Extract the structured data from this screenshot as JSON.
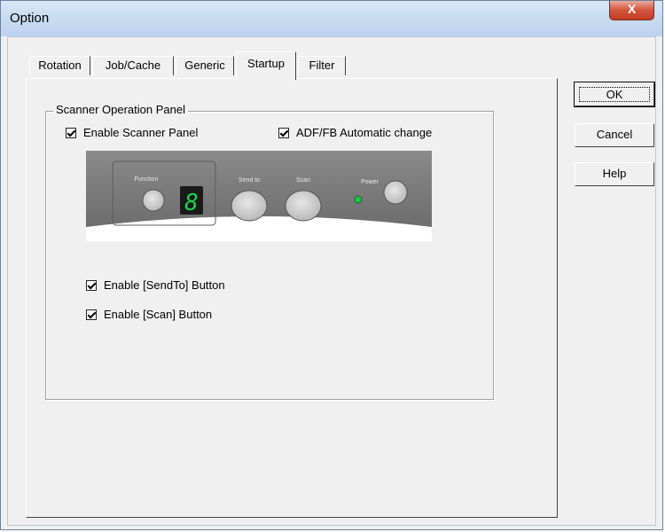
{
  "window": {
    "title": "Option",
    "close_glyph": "X"
  },
  "tabs": [
    {
      "label": "Rotation",
      "active": false
    },
    {
      "label": "Job/Cache",
      "active": false
    },
    {
      "label": "Generic",
      "active": false
    },
    {
      "label": "Startup",
      "active": true
    },
    {
      "label": "Filter",
      "active": false
    }
  ],
  "group": {
    "title": "Scanner Operation Panel",
    "enable_panel": {
      "label": "Enable Scanner Panel",
      "checked": true
    },
    "adf_fb_auto": {
      "label": "ADF/FB Automatic change",
      "checked": true
    },
    "panel_graphic": {
      "function_label": "Function",
      "display_digit": "8",
      "send_to_label": "Send to",
      "scan_label": "Scan",
      "power_label": "Power",
      "led_color": "#22c14a",
      "display_color": "#19d44b"
    },
    "enable_sendto": {
      "label": "Enable [SendTo] Button",
      "checked": true
    },
    "enable_scan": {
      "label": "Enable [Scan] Button",
      "checked": true
    }
  },
  "buttons": {
    "ok": "OK",
    "cancel": "Cancel",
    "help": "Help"
  }
}
